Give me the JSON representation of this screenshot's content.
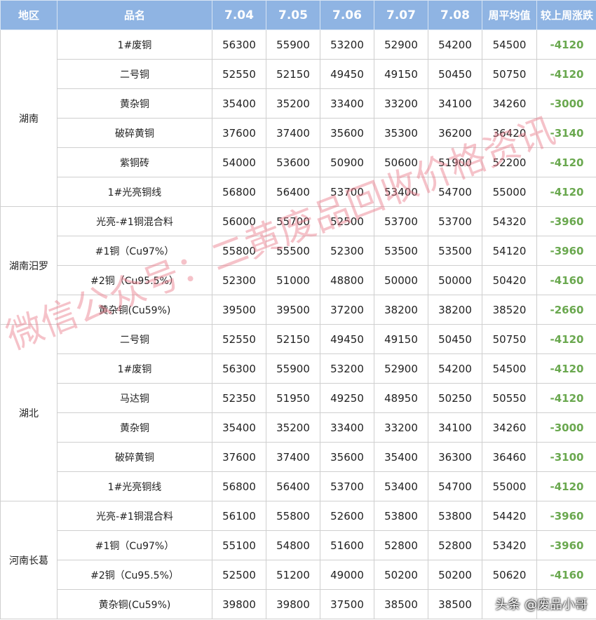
{
  "table": {
    "headers": [
      "地区",
      "品名",
      "7.04",
      "7.05",
      "7.06",
      "7.07",
      "7.08",
      "周平均值",
      "较上周涨跌"
    ],
    "groups": [
      {
        "region": "湖南",
        "rows": [
          {
            "item": "1#废铜",
            "prices": [
              "56300",
              "55900",
              "53200",
              "52900",
              "54200"
            ],
            "avg": "54500",
            "change": "-4120"
          },
          {
            "item": "二号铜",
            "prices": [
              "52550",
              "52150",
              "49450",
              "49150",
              "50450"
            ],
            "avg": "50750",
            "change": "-4120"
          },
          {
            "item": "黄杂铜",
            "prices": [
              "35400",
              "35200",
              "33400",
              "33200",
              "34100"
            ],
            "avg": "34260",
            "change": "-3000"
          },
          {
            "item": "破碎黄铜",
            "prices": [
              "37600",
              "37400",
              "35600",
              "35300",
              "36200"
            ],
            "avg": "36420",
            "change": "-3140"
          },
          {
            "item": "紫铜砖",
            "prices": [
              "54000",
              "53600",
              "50900",
              "50600",
              "51900"
            ],
            "avg": "52200",
            "change": "-4120"
          },
          {
            "item": "1#光亮铜线",
            "prices": [
              "56800",
              "56400",
              "53700",
              "53400",
              "54700"
            ],
            "avg": "55000",
            "change": "-4120"
          }
        ]
      },
      {
        "region": "湖南汨罗",
        "rows": [
          {
            "item": "光亮-#1铜混合料",
            "prices": [
              "56000",
              "55700",
              "52500",
              "53700",
              "53700"
            ],
            "avg": "54320",
            "change": "-3960"
          },
          {
            "item": "#1铜（Cu97%）",
            "prices": [
              "55800",
              "55500",
              "52300",
              "53500",
              "53500"
            ],
            "avg": "54120",
            "change": "-3960"
          },
          {
            "item": "#2铜（Cu95.5%）",
            "prices": [
              "52300",
              "51000",
              "48800",
              "50000",
              "50000"
            ],
            "avg": "50420",
            "change": "-4160"
          },
          {
            "item": "黄杂铜(Cu59%)",
            "prices": [
              "39500",
              "39500",
              "37200",
              "38200",
              "38200"
            ],
            "avg": "38520",
            "change": "-2660"
          }
        ]
      },
      {
        "region": "湖北",
        "rows": [
          {
            "item": "二号铜",
            "prices": [
              "52550",
              "52150",
              "49450",
              "49150",
              "50450"
            ],
            "avg": "50750",
            "change": "-4120"
          },
          {
            "item": "1#废铜",
            "prices": [
              "56300",
              "55900",
              "53200",
              "52900",
              "54200"
            ],
            "avg": "54500",
            "change": "-4120"
          },
          {
            "item": "马达铜",
            "prices": [
              "52350",
              "51950",
              "49250",
              "48950",
              "50250"
            ],
            "avg": "50550",
            "change": "-4120"
          },
          {
            "item": "黄杂铜",
            "prices": [
              "35400",
              "35200",
              "33400",
              "33200",
              "34100"
            ],
            "avg": "34260",
            "change": "-3000"
          },
          {
            "item": "破碎黄铜",
            "prices": [
              "37600",
              "37400",
              "35600",
              "35400",
              "36300"
            ],
            "avg": "36460",
            "change": "-3100"
          },
          {
            "item": "1#光亮铜线",
            "prices": [
              "56800",
              "56400",
              "53700",
              "53400",
              "54700"
            ],
            "avg": "55000",
            "change": "-4120"
          }
        ]
      },
      {
        "region": "河南长葛",
        "rows": [
          {
            "item": "光亮-#1铜混合料",
            "prices": [
              "56100",
              "55800",
              "52600",
              "53800",
              "53800"
            ],
            "avg": "54420",
            "change": "-3960"
          },
          {
            "item": "#1铜（Cu97%）",
            "prices": [
              "55100",
              "54800",
              "51600",
              "52800",
              "52800"
            ],
            "avg": "53420",
            "change": "-3960"
          },
          {
            "item": "#2铜（Cu95.5%）",
            "prices": [
              "52500",
              "51200",
              "49000",
              "50200",
              "50200"
            ],
            "avg": "50620",
            "change": "-4160"
          },
          {
            "item": "黄杂铜(Cu59%)",
            "prices": [
              "39800",
              "39800",
              "37500",
              "38500",
              "38500"
            ],
            "avg": "",
            "change": ""
          }
        ]
      }
    ]
  },
  "watermark": "微信公众号：二黄废品回收价格资讯",
  "credit": "头条 @废品小哥",
  "colors": {
    "header_bg": "#8fb4e3",
    "header_text": "#ffffff",
    "change_text": "#6aa84f",
    "grid": "#cfcfcf",
    "watermark": "#e97887"
  }
}
